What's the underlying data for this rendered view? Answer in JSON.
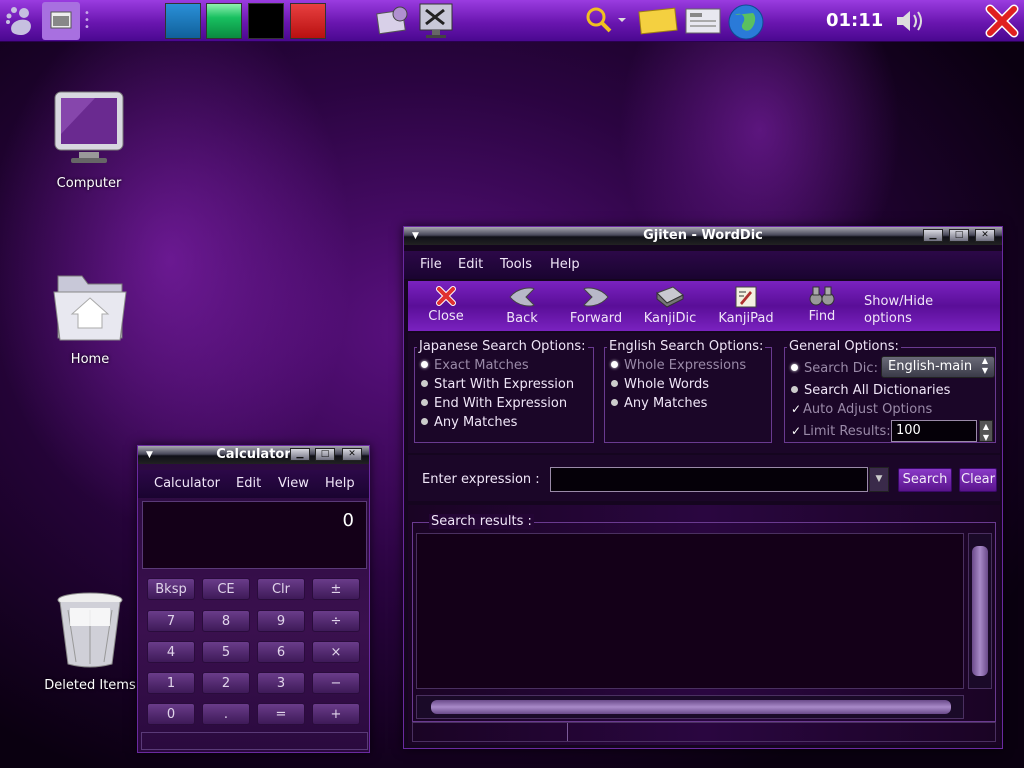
{
  "panel": {
    "clock": "01:11",
    "swatch_colors": [
      "#1a7fc8",
      "#18c060",
      "#000000",
      "#d82020"
    ]
  },
  "desktop": {
    "icons": [
      {
        "label": "Computer",
        "icon": "monitor-icon"
      },
      {
        "label": "Home",
        "icon": "home-folder-icon"
      },
      {
        "label": "Deleted Items",
        "icon": "trash-icon"
      }
    ]
  },
  "gjiten": {
    "title": "Gjiten - WordDic",
    "menu": [
      "File",
      "Edit",
      "Tools",
      "Help"
    ],
    "toolbar": [
      "Close",
      "Back",
      "Forward",
      "KanjiDic",
      "KanjiPad",
      "Find"
    ],
    "show_hide": [
      "Show/Hide",
      "options"
    ],
    "japanese": {
      "title": "Japanese Search Options:",
      "options": [
        "Exact Matches",
        "Start With Expression",
        "End With Expression",
        "Any Matches"
      ]
    },
    "english": {
      "title": "English Search Options:",
      "options": [
        "Whole Expressions",
        "Whole Words",
        "Any Matches"
      ]
    },
    "general": {
      "title": "General Options:",
      "search_dic_label": "Search Dic:",
      "search_dic_value": "English-main",
      "search_all": "Search All Dictionaries",
      "auto_adjust": "Auto Adjust Options",
      "limit_label": "Limit Results:",
      "limit_value": "100"
    },
    "enter_label": "Enter expression :",
    "search_button": "Search",
    "clear_button": "Clear",
    "results_label": "Search results :"
  },
  "calculator": {
    "title": "Calculator",
    "menu": [
      "Calculator",
      "Edit",
      "View",
      "Help"
    ],
    "display": "0",
    "keys": [
      [
        "Bksp",
        "CE",
        "Clr",
        "±"
      ],
      [
        "7",
        "8",
        "9",
        "÷"
      ],
      [
        "4",
        "5",
        "6",
        "×"
      ],
      [
        "1",
        "2",
        "3",
        "−"
      ],
      [
        "0",
        ".",
        "=",
        "+"
      ]
    ]
  }
}
